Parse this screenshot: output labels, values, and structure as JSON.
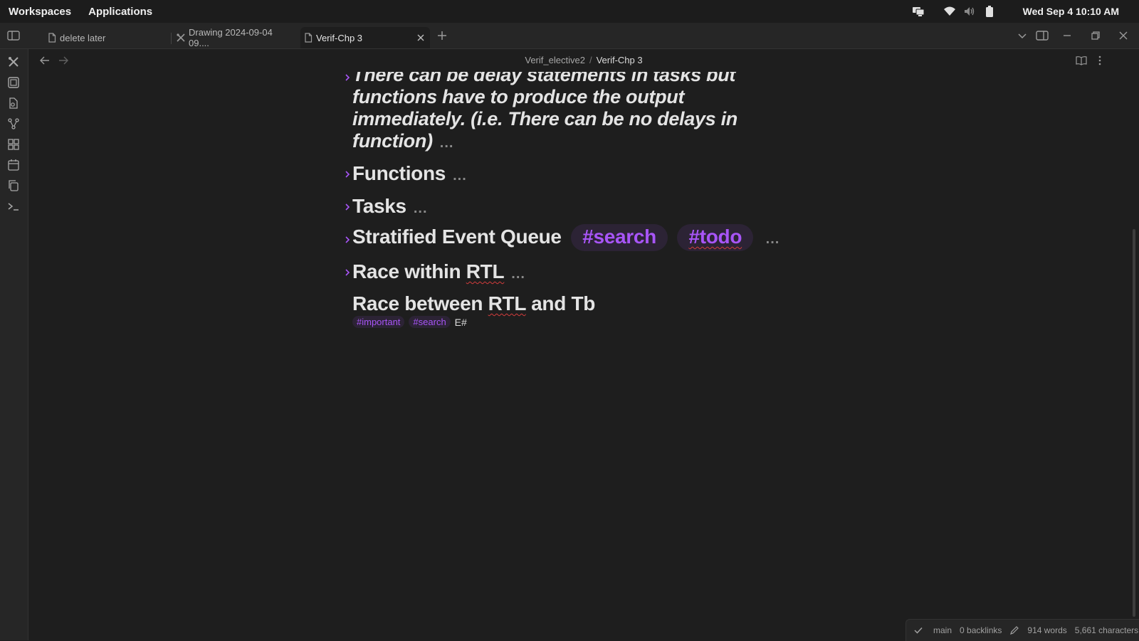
{
  "system": {
    "menus": [
      "Workspaces",
      "Applications"
    ],
    "clock": "Wed Sep 4  10:10 AM",
    "icons": [
      "display-icon",
      "wifi-icon",
      "volume-icon",
      "battery-icon"
    ]
  },
  "tabs": [
    {
      "label": "delete later",
      "icon": "file-icon",
      "active": false
    },
    {
      "label": "Drawing 2024-09-04 09....",
      "icon": "excalidraw-icon",
      "active": false
    },
    {
      "label": "Verif-Chp 3",
      "icon": "file-icon",
      "active": true
    }
  ],
  "breadcrumb": {
    "parent": "Verif_elective2",
    "separator": "/",
    "current": "Verif-Chp 3"
  },
  "content": {
    "italic_lines": [
      "There can be delay statements in tasks but",
      "functions have to produce the output",
      "immediately. (i.e. There can be no delays in",
      "function)"
    ],
    "ellipsis": "...",
    "headings": [
      {
        "text": "Functions"
      },
      {
        "text": "Tasks"
      },
      {
        "text": "Stratified Event Queue",
        "tags": [
          "#search",
          "#todo"
        ]
      },
      {
        "text_a": "Race within ",
        "text_b": "RTL"
      }
    ],
    "last_heading": {
      "a": "Race between ",
      "b": "RTL",
      "c": " and Tb"
    },
    "tags_line": {
      "tags": [
        "#important",
        "#search"
      ],
      "trailing": "E#"
    }
  },
  "status": {
    "branch": "main",
    "backlinks": "0 backlinks",
    "words": "914 words",
    "characters": "5,661 characters"
  },
  "colors": {
    "accent": "#a855f7",
    "background": "#1e1e1e",
    "sidebar": "#262626"
  }
}
